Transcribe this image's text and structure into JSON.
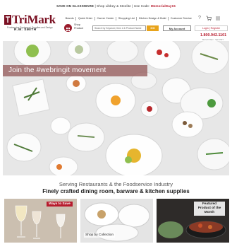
{
  "promo": {
    "prefix": "SAVE ON GLASSWARE",
    "middle": "| Shop Libbey & Steelite | Use Code:",
    "code": "MemorialDay15"
  },
  "brand": {
    "name": "TriMark",
    "tagline": "Foodservice Equipment, Supplies and Design",
    "sub": "R.W. SMITH"
  },
  "nav": [
    "Brands",
    "Quick Order",
    "Career Center",
    "Shopping List",
    "Kitchen Design & Build",
    "Customer Service"
  ],
  "icons": [
    "help-icon",
    "cart-icon",
    "menu-icon"
  ],
  "header": {
    "shop_label": "Shop Product",
    "search_placeholder": "Search by Keyword, Item # & Product Name",
    "go_label": "GO",
    "account_label": "My Account",
    "login_label": "Login | Register",
    "phone": "1.800.942.1101",
    "hours": "Mon-Fri 6am - 5pm PST"
  },
  "hero": {
    "banner": "Join the #webringit movement"
  },
  "tagline": {
    "line1": "Serving Restaurants & the Foodservice Industry",
    "line2": "Finely crafted dining room, barware & kitchen supplies"
  },
  "tiles": {
    "ways": "Ways to Save",
    "collection": "Shop by Collection",
    "featured": "Featured Product of the Month"
  }
}
